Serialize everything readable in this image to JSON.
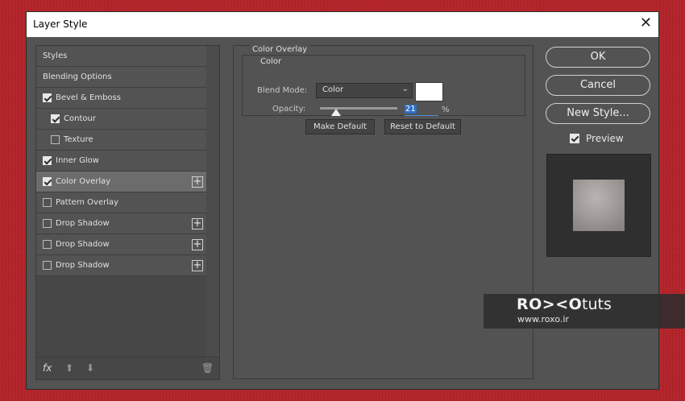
{
  "dialog": {
    "title": "Layer Style",
    "close": "✕"
  },
  "styles_list": [
    {
      "label": "Styles",
      "checkbox": null,
      "indent": false,
      "plus": false,
      "selected": false
    },
    {
      "label": "Blending Options",
      "checkbox": null,
      "indent": false,
      "plus": false,
      "selected": false
    },
    {
      "label": "Bevel & Emboss",
      "checkbox": true,
      "indent": false,
      "plus": false,
      "selected": false
    },
    {
      "label": "Contour",
      "checkbox": true,
      "indent": true,
      "plus": false,
      "selected": false
    },
    {
      "label": "Texture",
      "checkbox": false,
      "indent": true,
      "plus": false,
      "selected": false
    },
    {
      "label": "Inner Glow",
      "checkbox": true,
      "indent": false,
      "plus": false,
      "selected": false
    },
    {
      "label": "Color Overlay",
      "checkbox": true,
      "indent": false,
      "plus": true,
      "selected": true
    },
    {
      "label": "Pattern Overlay",
      "checkbox": false,
      "indent": false,
      "plus": false,
      "selected": false
    },
    {
      "label": "Drop Shadow",
      "checkbox": false,
      "indent": false,
      "plus": true,
      "selected": false
    },
    {
      "label": "Drop Shadow",
      "checkbox": false,
      "indent": false,
      "plus": true,
      "selected": false
    },
    {
      "label": "Drop Shadow",
      "checkbox": false,
      "indent": false,
      "plus": true,
      "selected": false
    }
  ],
  "footer": {
    "fx": "fx",
    "up": "⬆",
    "down": "⬇",
    "trash": "🗑"
  },
  "panel": {
    "section_title": "Color Overlay",
    "group_title": "Color",
    "blend_mode_label": "Blend Mode:",
    "blend_mode_value": "Color",
    "overlay_color": "#ffffff",
    "opacity_label": "Opacity:",
    "opacity_value": "21",
    "opacity_unit": "%",
    "opacity_fraction": 0.21,
    "make_default": "Make Default",
    "reset_default": "Reset to Default"
  },
  "buttons": {
    "ok": "OK",
    "cancel": "Cancel",
    "new_style": "New Style..."
  },
  "preview": {
    "label": "Preview",
    "checked": true
  },
  "watermark": {
    "brand": "RO><O",
    "tuts": "tuts",
    "url": "www.roxo.ir"
  }
}
